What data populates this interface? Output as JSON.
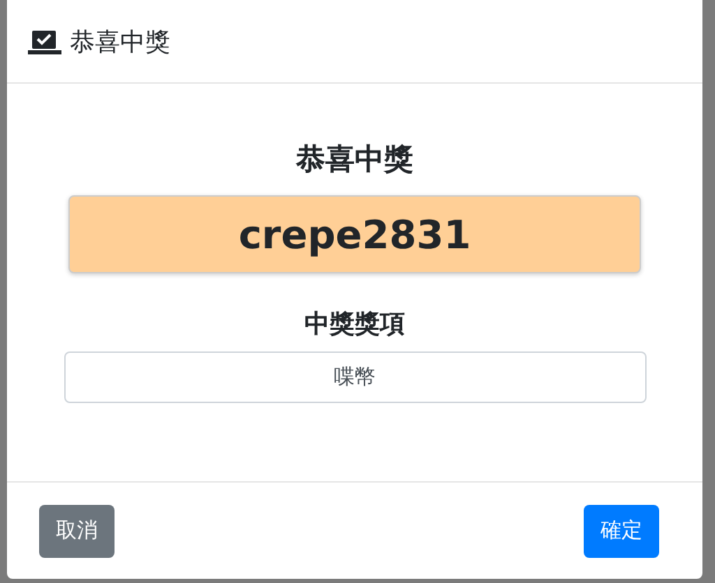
{
  "modal": {
    "title": "恭喜中獎"
  },
  "body": {
    "heading": "恭喜中獎",
    "winner": "crepe2831",
    "prize_label": "中獎獎項",
    "prize": {
      "value": "喋幣"
    }
  },
  "buttons": [
    {
      "label": "取消",
      "kind": "secondary"
    },
    {
      "label": "確定",
      "kind": "primary"
    }
  ]
}
